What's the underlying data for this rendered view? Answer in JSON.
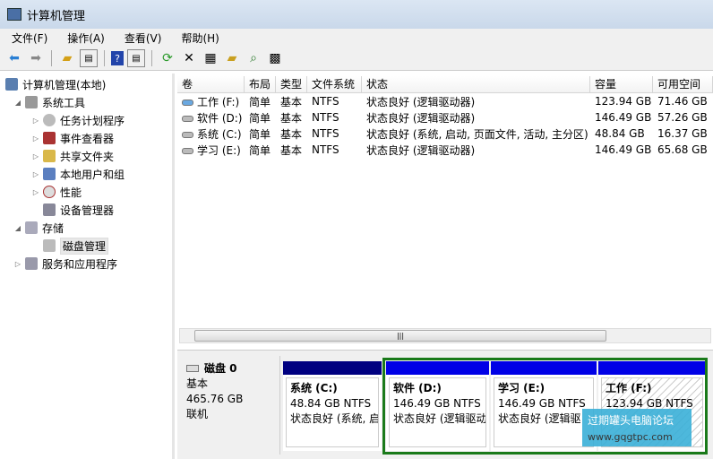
{
  "window": {
    "title": "计算机管理"
  },
  "menu": [
    "文件(F)",
    "操作(A)",
    "查看(V)",
    "帮助(H)"
  ],
  "toolbar": [
    "back-icon",
    "forward-icon",
    "up-folder-icon",
    "show-hide-tree-icon",
    "help-icon",
    "show-hide-action-icon",
    "refresh-icon",
    "delete-icon",
    "properties-icon",
    "open-icon",
    "search-icon",
    "settings-icon"
  ],
  "tree": {
    "root": "计算机管理(本地)",
    "items": [
      {
        "label": "系统工具",
        "level": 1
      },
      {
        "label": "任务计划程序",
        "level": 2
      },
      {
        "label": "事件查看器",
        "level": 2
      },
      {
        "label": "共享文件夹",
        "level": 2
      },
      {
        "label": "本地用户和组",
        "level": 2
      },
      {
        "label": "性能",
        "level": 2
      },
      {
        "label": "设备管理器",
        "level": 2
      },
      {
        "label": "存储",
        "level": 1
      },
      {
        "label": "磁盘管理",
        "level": 2,
        "selected": true
      },
      {
        "label": "服务和应用程序",
        "level": 1
      }
    ]
  },
  "volumes": {
    "columns": [
      "卷",
      "布局",
      "类型",
      "文件系统",
      "状态",
      "容量",
      "可用空间"
    ],
    "rows": [
      [
        "工作 (F:)",
        "简单",
        "基本",
        "NTFS",
        "状态良好 (逻辑驱动器)",
        "123.94 GB",
        "71.46 GB"
      ],
      [
        "软件 (D:)",
        "简单",
        "基本",
        "NTFS",
        "状态良好 (逻辑驱动器)",
        "146.49 GB",
        "57.26 GB"
      ],
      [
        "系统 (C:)",
        "简单",
        "基本",
        "NTFS",
        "状态良好 (系统, 启动, 页面文件, 活动, 主分区)",
        "48.84 GB",
        "16.37 GB"
      ],
      [
        "学习 (E:)",
        "简单",
        "基本",
        "NTFS",
        "状态良好 (逻辑驱动器)",
        "146.49 GB",
        "65.68 GB"
      ]
    ]
  },
  "disk": {
    "name": "磁盘 0",
    "type": "基本",
    "size": "465.76 GB",
    "status": "联机",
    "partitions": [
      {
        "name": "系统  (C:)",
        "size": "48.84 GB NTFS",
        "status": "状态良好 (系统, 启",
        "color": "#000080"
      },
      {
        "name": "软件  (D:)",
        "size": "146.49 GB NTFS",
        "status": "状态良好 (逻辑驱动",
        "color": "#0000e6"
      },
      {
        "name": "学习  (E:)",
        "size": "146.49 GB NTFS",
        "status": "状态良好 (逻辑驱",
        "color": "#0000e6"
      },
      {
        "name": "工作  (F:)",
        "size": "123.94 GB NTFS",
        "status": "",
        "color": "#0000e6"
      }
    ]
  },
  "watermark": {
    "title": "过期罐头电脑论坛",
    "url": "www.gqgtpc.com"
  }
}
